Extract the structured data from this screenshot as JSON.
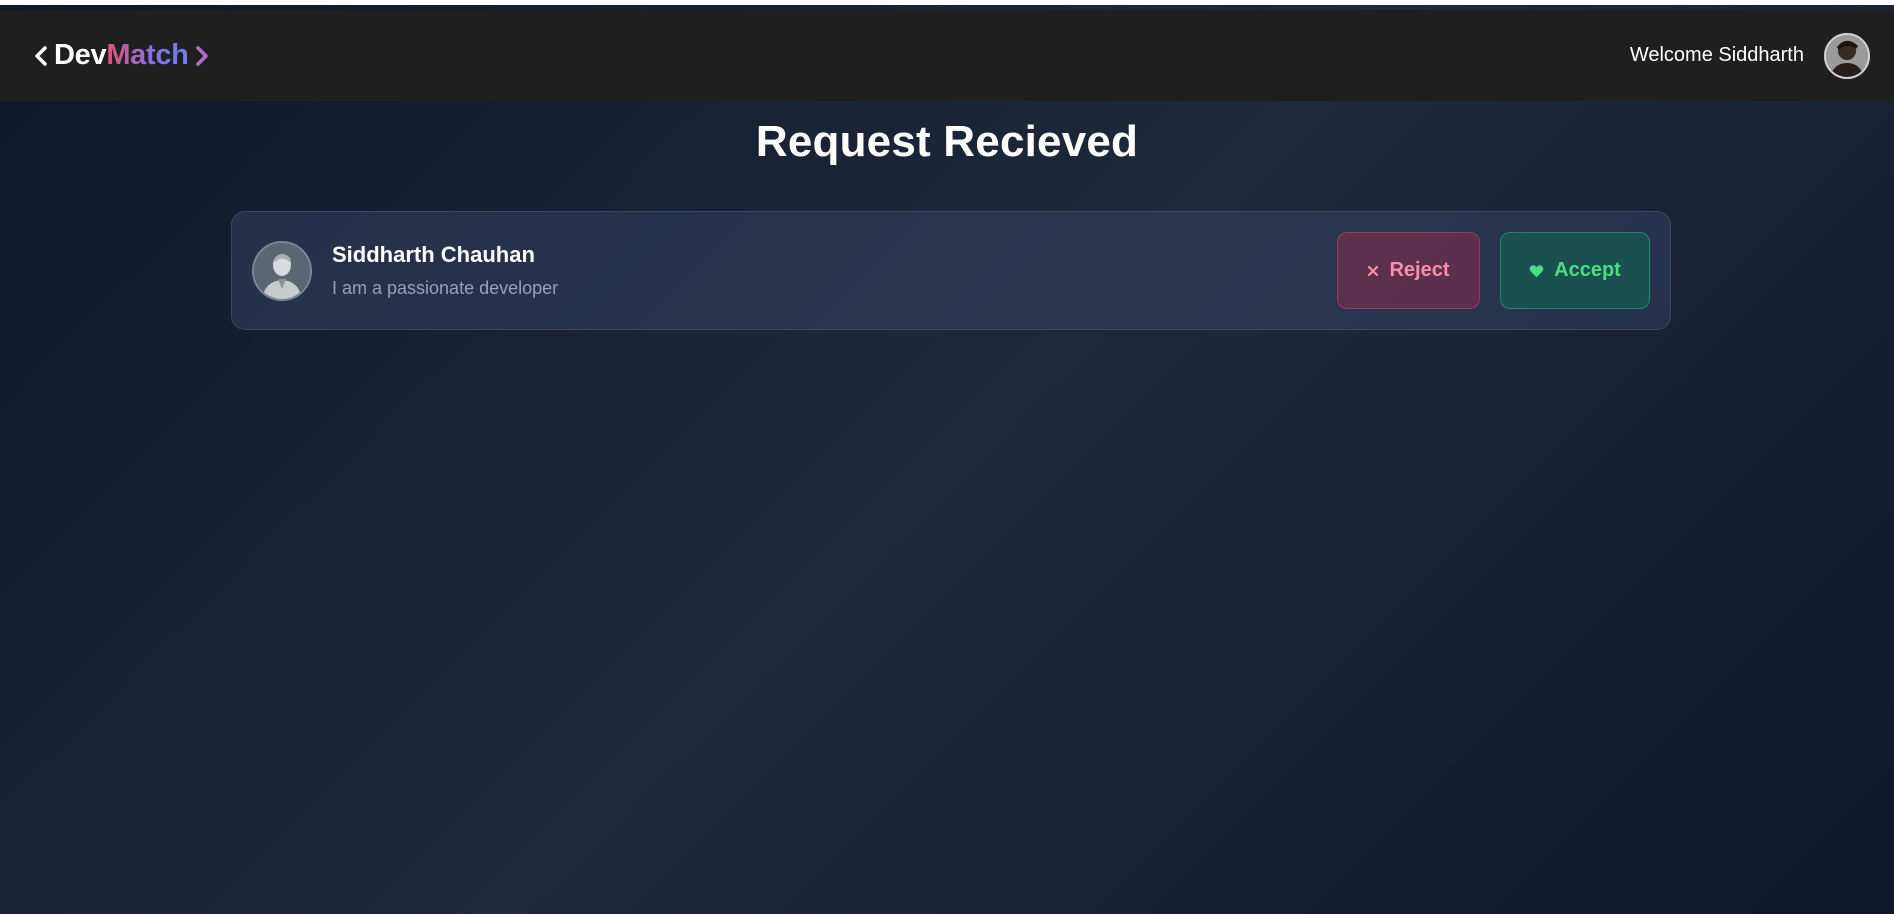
{
  "navbar": {
    "brand_part1": "Dev",
    "brand_part2": "Match",
    "welcome_text": "Welcome Siddharth"
  },
  "page": {
    "title": "Request Recieved"
  },
  "requests": [
    {
      "name": "Siddharth Chauhan",
      "bio": "I am a passionate developer",
      "reject_label": "Reject",
      "accept_label": "Accept"
    }
  ],
  "icons": {
    "brand_left": "chevron-left-icon",
    "brand_right": "chevron-right-icon",
    "reject": "close-icon",
    "accept": "heart-icon"
  },
  "colors": {
    "accent_pink": "#e05478",
    "accent_purple": "#6a7ff0",
    "reject_text": "#fb8fa8",
    "accept_text": "#4ade80"
  }
}
